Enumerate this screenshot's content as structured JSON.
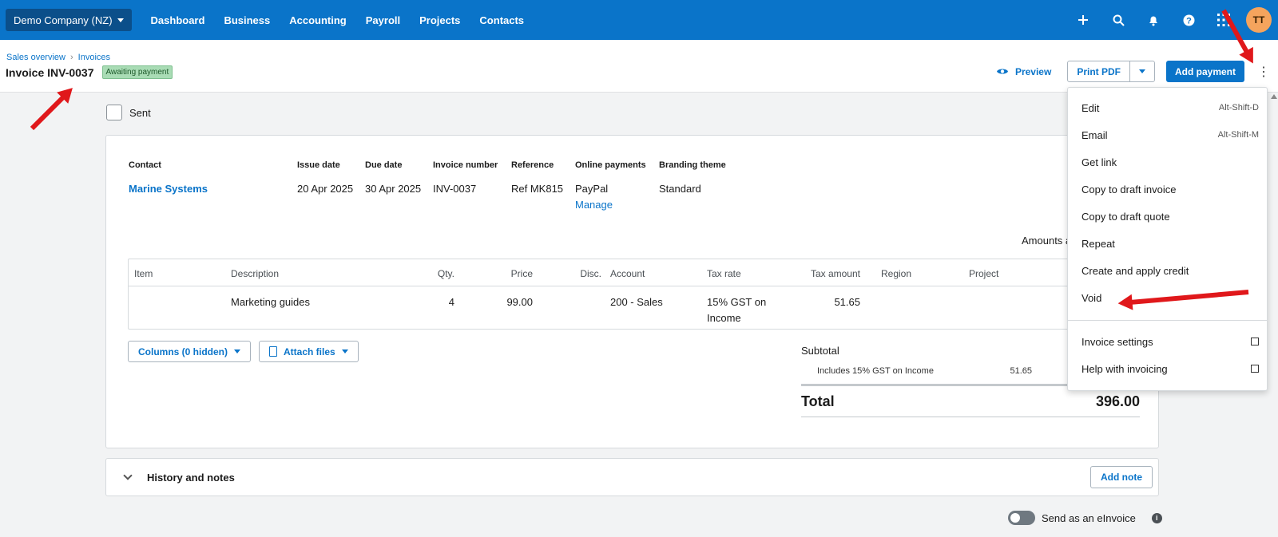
{
  "topbar": {
    "org": "Demo Company (NZ)",
    "nav": [
      "Dashboard",
      "Business",
      "Accounting",
      "Payroll",
      "Projects",
      "Contacts"
    ],
    "avatar": "TT",
    "icons": [
      "plus-icon",
      "search-icon",
      "bell-icon",
      "help-icon",
      "apps-grid-icon"
    ]
  },
  "breadcrumb": {
    "first": "Sales overview",
    "sep": "›",
    "second": "Invoices"
  },
  "invoice": {
    "title": "Invoice INV-0037",
    "status": "Awaiting payment"
  },
  "actions": {
    "preview": "Preview",
    "print": "Print PDF",
    "add_payment": "Add payment",
    "more": "⋮"
  },
  "sent": {
    "label": "Sent",
    "checked": false
  },
  "meta": {
    "contact_label": "Contact",
    "contact": "Marine Systems",
    "issue_label": "Issue date",
    "issue": "20 Apr 2025",
    "due_label": "Due date",
    "due": "30 Apr 2025",
    "number_label": "Invoice number",
    "number": "INV-0037",
    "ref_label": "Reference",
    "ref": "Ref MK815",
    "online_label": "Online payments",
    "online": "PayPal",
    "online_link": "Manage",
    "brand_label": "Branding theme",
    "brand": "Standard"
  },
  "amounts_label": "Amounts a",
  "table": {
    "headers": {
      "item": "Item",
      "desc": "Description",
      "qty": "Qty.",
      "price": "Price",
      "disc": "Disc.",
      "account": "Account",
      "taxrate": "Tax rate",
      "taxamt": "Tax amount",
      "region": "Region",
      "project": "Project"
    },
    "row": {
      "desc": "Marketing guides",
      "qty": "4",
      "price": "99.00",
      "account": "200 - Sales",
      "taxrate": "15% GST on Income",
      "taxamt": "51.65"
    }
  },
  "buttons": {
    "columns": "Columns (0 hidden)",
    "attach": "Attach files"
  },
  "totals": {
    "subtotal_label": "Subtotal",
    "gst_label": "Includes 15% GST on Income",
    "gst": "51.65",
    "total_label": "Total",
    "total": "396.00"
  },
  "history": {
    "title": "History and notes",
    "add_note": "Add note"
  },
  "einvoice": {
    "label": "Send as an eInvoice",
    "enabled": false
  },
  "menu": {
    "edit": "Edit",
    "edit_sc": "Alt-Shift-D",
    "email": "Email",
    "email_sc": "Alt-Shift-M",
    "getlink": "Get link",
    "copy_invoice": "Copy to draft invoice",
    "copy_quote": "Copy to draft quote",
    "repeat": "Repeat",
    "credit": "Create and apply credit",
    "void": "Void",
    "settings": "Invoice settings",
    "help": "Help with invoicing"
  },
  "colors": {
    "brand": "#0a74c9",
    "annotation": "#e0181b"
  }
}
